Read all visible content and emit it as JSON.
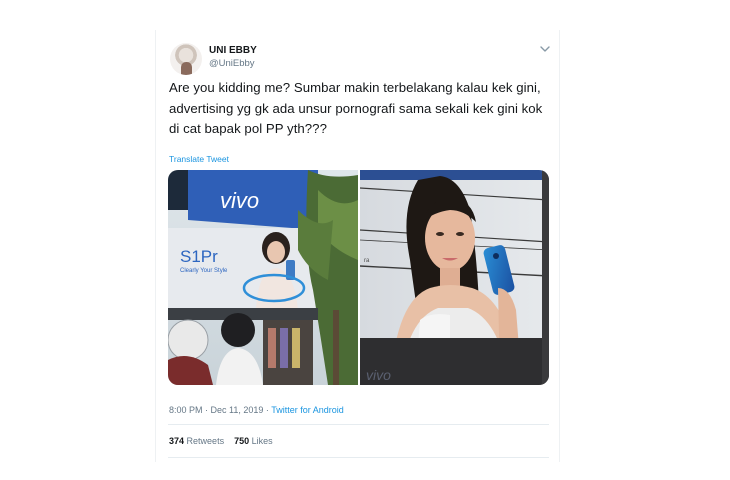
{
  "user": {
    "name": "UNI EBBY",
    "handle": "@UniEbby"
  },
  "tweet": {
    "text": "Are you kidding me? Sumbar makin terbelakang kalau kek gini, advertising yg gk ada unsur pornografi sama sekali kek gini kok di cat bapak pol PP yth???",
    "translate_label": "Translate Tweet"
  },
  "media": {
    "left_billboard": {
      "brand": "vivo",
      "model": "S1Pr",
      "tagline": "Clearly Your Style"
    },
    "right_billboard": {
      "brand": "vivo",
      "side_text": "ra"
    }
  },
  "meta": {
    "time": "8:00 PM",
    "separator": " · ",
    "date": "Dec 11, 2019",
    "source": "Twitter for Android"
  },
  "stats": {
    "retweets_count": "374",
    "retweets_label": "Retweets",
    "likes_count": "750",
    "likes_label": "Likes"
  },
  "colors": {
    "link": "#1b95e0",
    "secondary_text": "#657786",
    "circle_annotation": "#2f8fd8"
  }
}
